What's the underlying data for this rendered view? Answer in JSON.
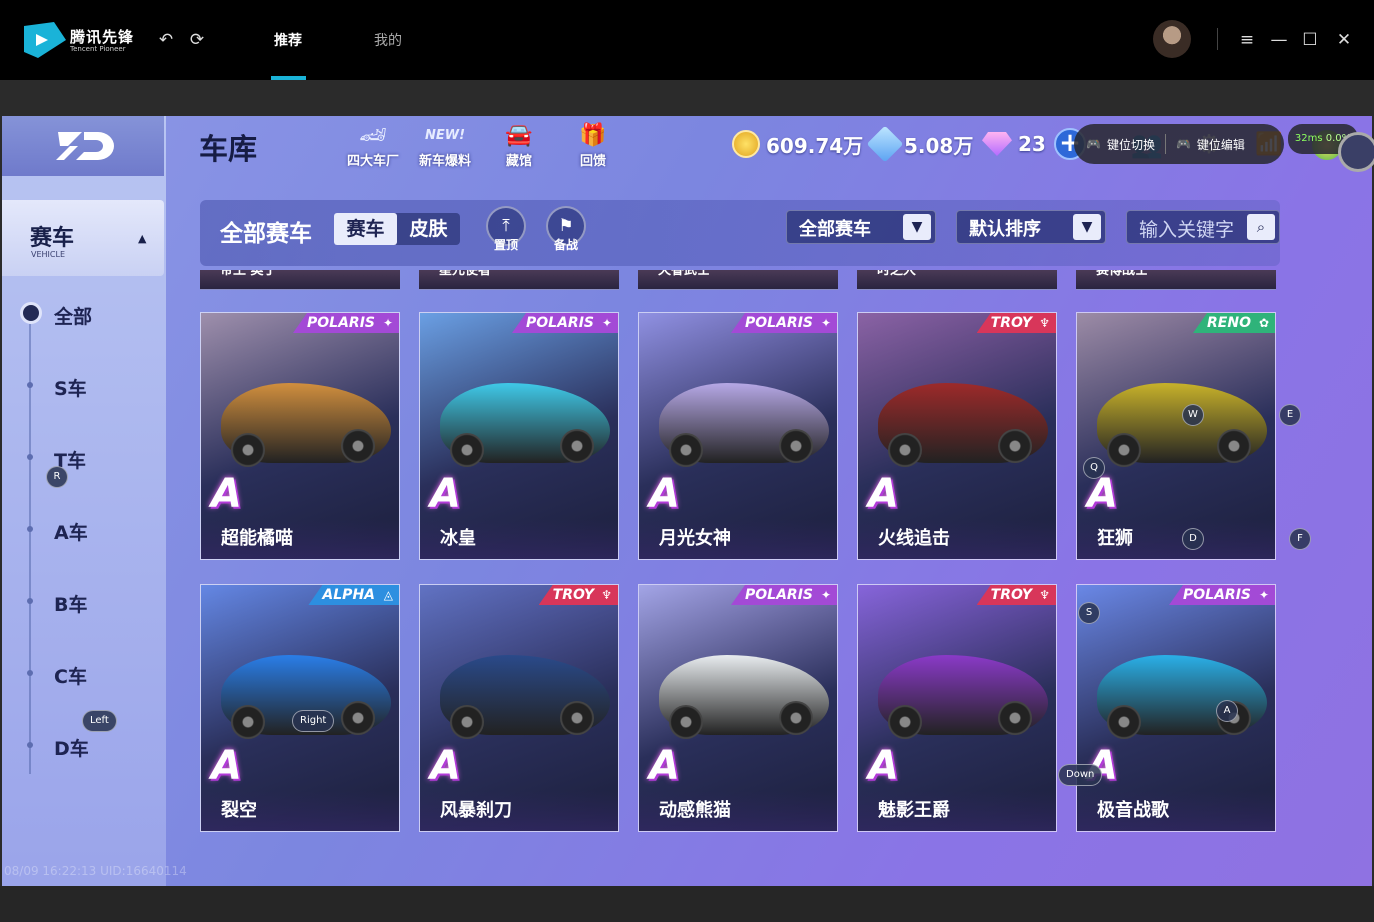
{
  "app": {
    "name_cn": "腾讯先锋",
    "name_en": "Tencent Pioneer"
  },
  "titlebar": {
    "tabs": [
      {
        "label": "推荐",
        "active": true
      },
      {
        "label": "我的",
        "active": false
      }
    ]
  },
  "overlay": {
    "key_switch": "键位切换",
    "key_edit": "键位编辑",
    "ping": "32ms",
    "loss": "0.0%"
  },
  "header": {
    "title": "车库",
    "buttons": [
      {
        "label": "四大车厂",
        "icon": "factory-icon"
      },
      {
        "label": "新车爆料",
        "icon": "new-badge-icon"
      },
      {
        "label": "藏馆",
        "icon": "car-gallery-icon"
      },
      {
        "label": "回馈",
        "icon": "gift-box-icon"
      }
    ],
    "coins": "609.74万",
    "tickets": "5.08万",
    "gems": "23"
  },
  "sidebar": {
    "tab_title": "赛车",
    "tab_sub": "VEHICLE",
    "categories": [
      "全部",
      "S车",
      "T车",
      "A车",
      "B车",
      "C车",
      "D车"
    ]
  },
  "filter": {
    "title": "全部赛车",
    "seg": [
      "赛车",
      "皮肤"
    ],
    "pin_label": "置顶",
    "prep_label": "备战",
    "type_select": "全部赛车",
    "sort_select": "默认排序",
    "search_placeholder": "输入关键字"
  },
  "peek_names": [
    "帝王 奥丁",
    "星元使者",
    "天眷武士",
    "时之大",
    "赛博战士"
  ],
  "cars": [
    {
      "name": "超能橘喵",
      "brand": "POLARIS",
      "grade": "A",
      "color": "#d18f3e"
    },
    {
      "name": "冰皇",
      "brand": "POLARIS",
      "grade": "A",
      "color": "#3fc9e8"
    },
    {
      "name": "月光女神",
      "brand": "POLARIS",
      "grade": "A",
      "color": "#b6a8e6"
    },
    {
      "name": "火线追击",
      "brand": "TROY",
      "grade": "A",
      "color": "#9d2a2a"
    },
    {
      "name": "狂狮",
      "brand": "RENO",
      "grade": "A",
      "color": "#c8b22a"
    },
    {
      "name": "裂空",
      "brand": "ALPHA",
      "grade": "A",
      "color": "#2a7ee8"
    },
    {
      "name": "风暴刹刀",
      "brand": "TROY",
      "grade": "A",
      "color": "#2a4a8a"
    },
    {
      "name": "动感熊猫",
      "brand": "POLARIS",
      "grade": "A",
      "color": "#e8ecef"
    },
    {
      "name": "魅影王爵",
      "brand": "TROY",
      "grade": "A",
      "color": "#8a3ac8"
    },
    {
      "name": "极音战歌",
      "brand": "POLARIS",
      "grade": "A",
      "color": "#2ab0e8"
    }
  ],
  "key_hints": [
    "E",
    "Q",
    "W",
    "D",
    "F",
    "R",
    "Right",
    "Left",
    "S",
    "A",
    "Down"
  ],
  "footer": {
    "uid_line": "08/09 16:22:13 UID:16640114"
  }
}
